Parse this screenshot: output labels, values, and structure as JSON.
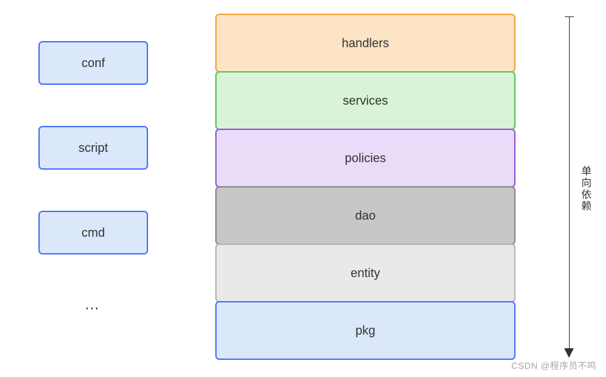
{
  "left_items": {
    "conf": "conf",
    "script": "script",
    "cmd": "cmd",
    "ellipsis": "…"
  },
  "layers": {
    "handlers": "handlers",
    "services": "services",
    "policies": "policies",
    "dao": "dao",
    "entity": "entity",
    "pkg": "pkg"
  },
  "arrow": {
    "label": "单向依赖"
  },
  "watermark": "CSDN @程序员不鸣"
}
